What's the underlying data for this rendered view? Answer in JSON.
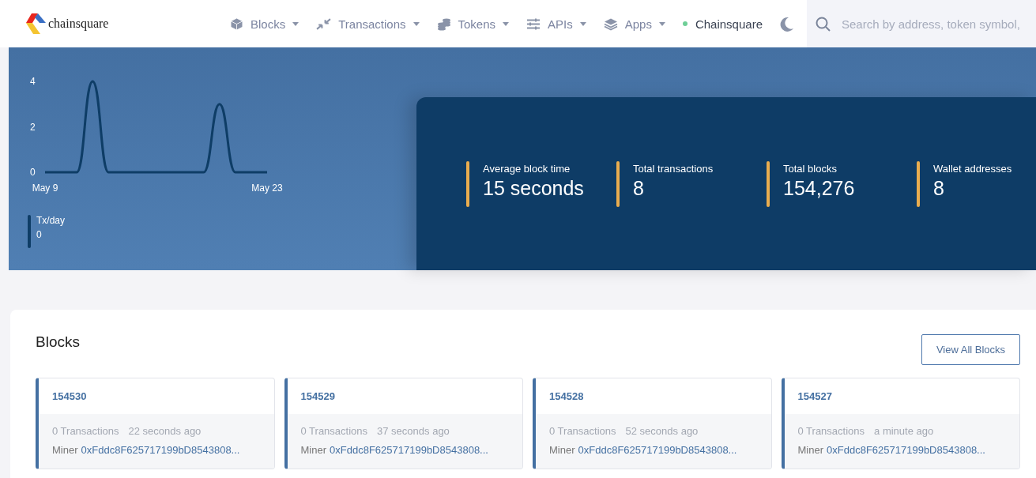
{
  "brand": {
    "name": "chainsquare"
  },
  "nav": [
    {
      "label": "Blocks"
    },
    {
      "label": "Transactions"
    },
    {
      "label": "Tokens"
    },
    {
      "label": "APIs"
    },
    {
      "label": "Apps"
    }
  ],
  "network": {
    "label": "Chainsquare",
    "color": "#6fcf97"
  },
  "search": {
    "placeholder": "Search by address, token symbol,"
  },
  "chart": {
    "chart_data": {
      "type": "line",
      "series": [
        {
          "name": "Tx/day",
          "color": "#0e3d66",
          "values": [
            0,
            0,
            0,
            4,
            0,
            0,
            0,
            0,
            0,
            0,
            0,
            3,
            0,
            0,
            0
          ]
        }
      ],
      "categories": [
        "May 9",
        null,
        null,
        null,
        null,
        null,
        null,
        null,
        null,
        null,
        null,
        null,
        null,
        null,
        "May 23"
      ],
      "ylim": [
        0,
        4
      ],
      "yticks": [
        0,
        2,
        4
      ]
    },
    "legend_value": "0"
  },
  "stats": [
    {
      "label": "Average block time",
      "value": "15 seconds"
    },
    {
      "label": "Total transactions",
      "value": "8"
    },
    {
      "label": "Total blocks",
      "value": "154,276"
    },
    {
      "label": "Wallet addresses",
      "value": "8"
    }
  ],
  "blocks": {
    "title": "Blocks",
    "button": "View All Blocks",
    "items": [
      {
        "number": "154530",
        "transactions": "0 Transactions",
        "age": "22 seconds ago",
        "miner_label": "Miner",
        "miner": "0xFddc8F625717199bD8543808..."
      },
      {
        "number": "154529",
        "transactions": "0 Transactions",
        "age": "37 seconds ago",
        "miner_label": "Miner",
        "miner": "0xFddc8F625717199bD8543808..."
      },
      {
        "number": "154528",
        "transactions": "0 Transactions",
        "age": "52 seconds ago",
        "miner_label": "Miner",
        "miner": "0xFddc8F625717199bD8543808..."
      },
      {
        "number": "154527",
        "transactions": "0 Transactions",
        "age": "a minute ago",
        "miner_label": "Miner",
        "miner": "0xFddc8F625717199bD8543808..."
      }
    ]
  }
}
